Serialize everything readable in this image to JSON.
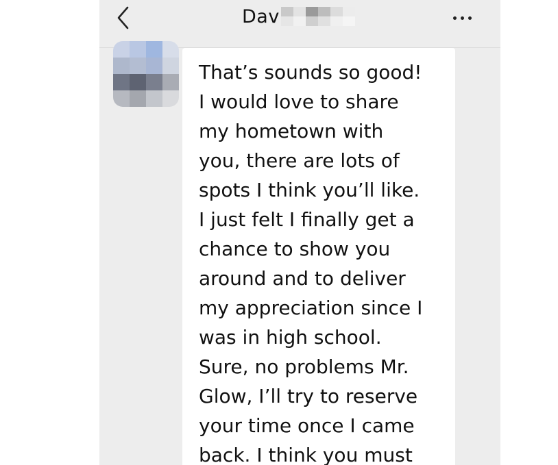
{
  "header": {
    "title_visible": "Dav",
    "back_icon": "chevron-left-icon",
    "more_icon": "more-horizontal-icon"
  },
  "chat": {
    "messages": [
      {
        "sender": "contact",
        "text": "That’s sounds so good!\nI would love to share\nmy hometown with\nyou, there are lots of\nspots I think you’ll like.\nI just felt I finally get a\nchance to show you\naround and to deliver\nmy appreciation since I\nwas in high school.\nSure, no problems Mr.\nGlow, I’ll try to reserve\nyour time once I came\nback. I think you must"
      }
    ]
  },
  "colors": {
    "background": "#ededed",
    "bubble": "#ffffff",
    "text": "#111111"
  }
}
